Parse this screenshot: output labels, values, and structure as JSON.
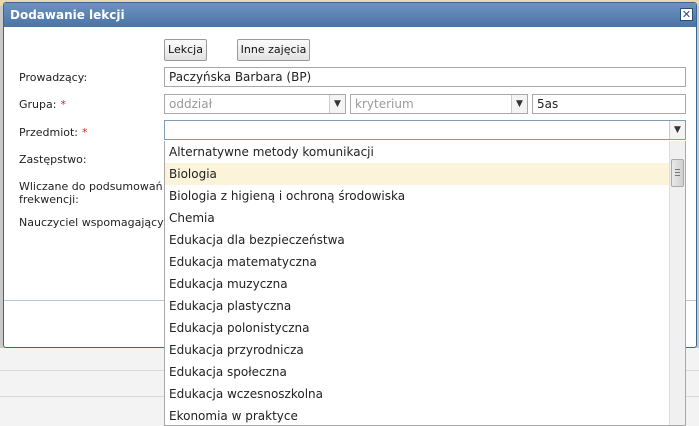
{
  "dialog": {
    "title": "Dodawanie lekcji",
    "close_glyph": "✕",
    "buttons": {
      "lesson": "Lekcja",
      "other": "Inne zajęcia"
    }
  },
  "form": {
    "teacher": {
      "label": "Prowadzący:",
      "value": "Paczyńska Barbara (BP)"
    },
    "group": {
      "label": "Grupa:",
      "required_mark": "*",
      "class_placeholder": "oddział",
      "criterion_placeholder": "kryterium",
      "value": "5as"
    },
    "subject": {
      "label": "Przedmiot:",
      "required_mark": "*",
      "value": ""
    },
    "substitution": {
      "label": "Zastępstwo:"
    },
    "attendance": {
      "label_line1": "Wliczane do podsumowań",
      "label_line2": "frekwencji:"
    },
    "assistant": {
      "label": "Nauczyciel wspomagający:"
    }
  },
  "subject_options": [
    "Alternatywne metody komunikacji",
    "Biologia",
    "Biologia z higieną i ochroną środowiska",
    "Chemia",
    "Edukacja dla bezpieczeństwa",
    "Edukacja matematyczna",
    "Edukacja muzyczna",
    "Edukacja plastyczna",
    "Edukacja polonistyczna",
    "Edukacja przyrodnicza",
    "Edukacja społeczna",
    "Edukacja wczesnoszkolna",
    "Ekonomia w praktyce"
  ],
  "highlighted_option": "Biologia",
  "icons": {
    "dropdown_arrow": "▼",
    "scroll_up": "▲",
    "scroll_down": "▼"
  }
}
